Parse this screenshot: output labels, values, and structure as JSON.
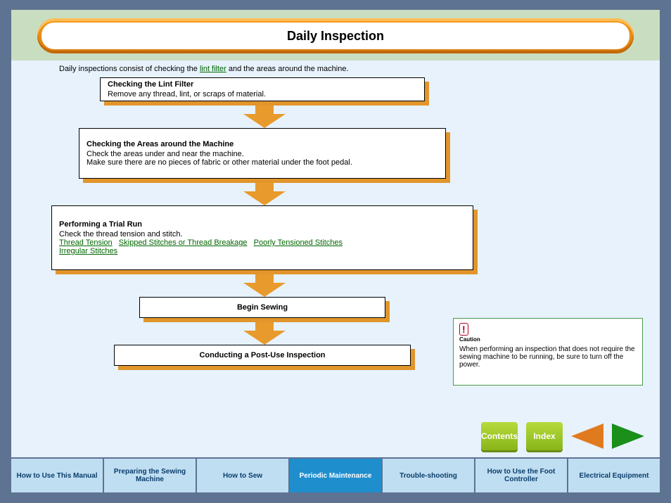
{
  "header": {
    "title": "Daily Inspection"
  },
  "flow": {
    "intro_prefix": "Daily inspections consist of checking the ",
    "intro_link": "lint filter",
    "intro_suffix": " and the areas around the machine.",
    "steps": [
      {
        "title": "Checking the Lint Filter",
        "body": "Remove any thread, lint, or scraps of material."
      },
      {
        "title": "Checking the Areas around the Machine",
        "body": "Check the areas under and near the machine.\nMake sure there are no pieces of fabric or other material under the foot pedal."
      },
      {
        "title": "Performing a Trial Run",
        "body_prefix": "Check the thread tension and stitch.\n",
        "links": [
          "Thread Tension",
          "Skipped Stitches or Thread Breakage",
          "Poorly Tensioned Stitches",
          "Irregular Stitches"
        ]
      },
      {
        "title": "Begin Sewing",
        "body": ""
      },
      {
        "title": "Conducting a Post-Use Inspection",
        "body": ""
      }
    ]
  },
  "caution": {
    "label": "Caution",
    "text": "When performing an inspection that does not require the sewing machine to be running, be sure to turn off the power."
  },
  "nav": {
    "contents": "Contents",
    "index": "Index"
  },
  "tabs": [
    "How to Use This Manual",
    "Preparing the Sewing Machine",
    "How to Sew",
    "Periodic Maintenance",
    "Trouble-shooting",
    "How to Use the Foot Controller",
    "Electrical Equipment"
  ],
  "active_tab": 3,
  "colors": {
    "accent": "#e89a2c",
    "link": "#006600",
    "nav_green": "#2aa82a",
    "nav_orange": "#e07a1f"
  }
}
